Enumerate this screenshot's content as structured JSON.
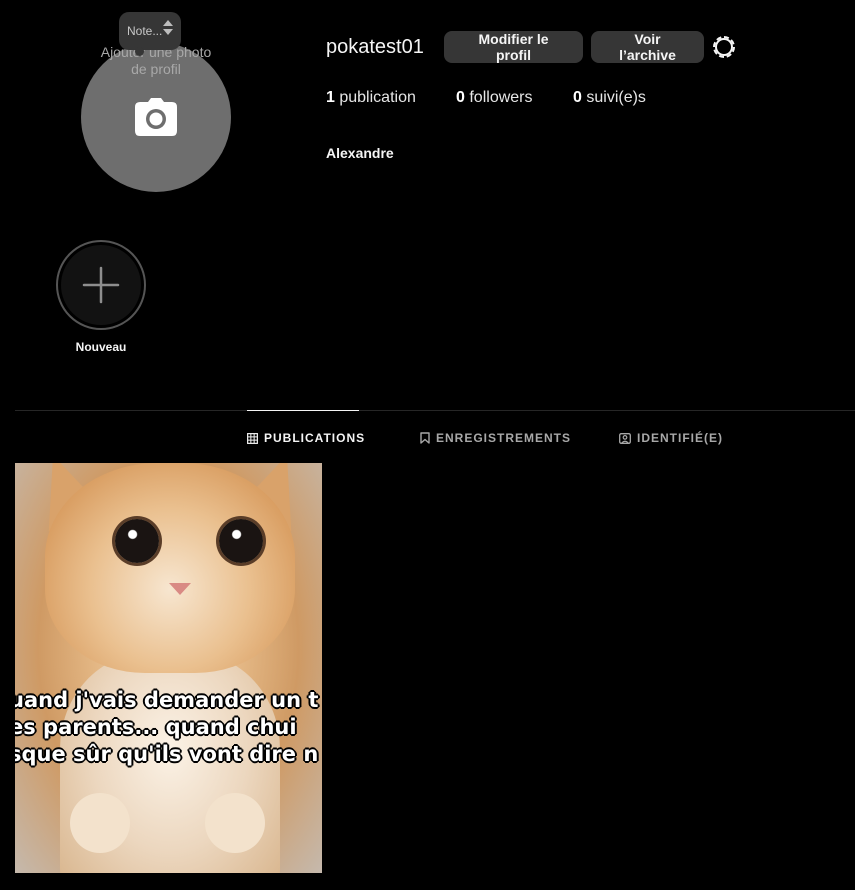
{
  "profile": {
    "avatar_hint": "Ajouter une photo de profil",
    "note_label": "Note...",
    "username": "pokatest01",
    "edit_button": "Modifier le profil",
    "archive_button": "Voir l’archive",
    "full_name": "Alexandre"
  },
  "stats": {
    "publications_count": "1",
    "publications_label": "publication",
    "followers_count": "0",
    "followers_label": "followers",
    "following_count": "0",
    "following_label": "suivi(e)s"
  },
  "highlights": [
    {
      "label": "Nouveau",
      "icon": "plus-icon"
    }
  ],
  "tabs": [
    {
      "label": "PUBLICATIONS",
      "icon": "grid-icon",
      "active": true
    },
    {
      "label": "ENREGISTREMENTS",
      "icon": "bookmark-icon",
      "active": false
    },
    {
      "label": "IDENTIFIÉ(E)",
      "icon": "tagged-icon",
      "active": false
    }
  ],
  "posts": [
    {
      "caption_lines": [
        "uand j'vais demander un t",
        "es parents... quand chui",
        "sque sûr qu'ils vont dire n"
      ]
    }
  ],
  "colors": {
    "background": "#000000",
    "button": "#363636",
    "avatar": "#6e6e6e",
    "muted_text": "#a8a8a8"
  }
}
